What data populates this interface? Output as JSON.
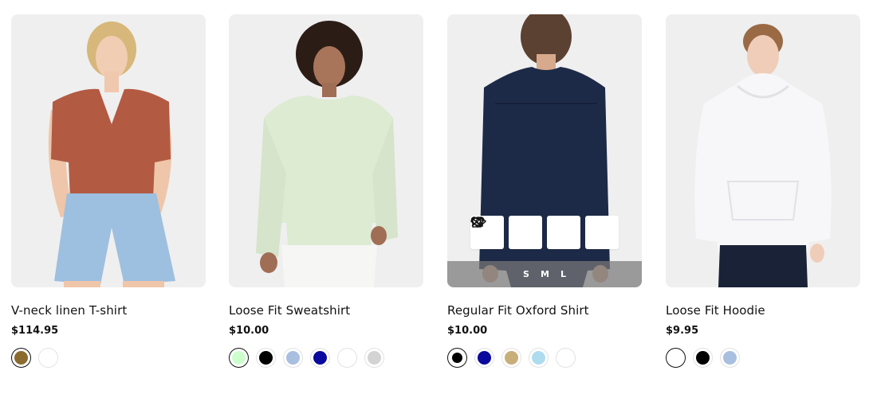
{
  "products": [
    {
      "title": "V-neck linen T-shirt",
      "price": "$114.95",
      "image_alt": "Woman in rust V-neck linen T-shirt and denim shorts",
      "swatches": [
        "#8B6B2E",
        "#FFFFFF"
      ]
    },
    {
      "title": "Loose Fit Sweatshirt",
      "price": "$10.00",
      "image_alt": "Man in pale green loose fit sweatshirt",
      "swatches": [
        "#CCFFCC",
        "#000000",
        "#A8BFE0",
        "#0A0A9E",
        "#FFFFFF",
        "#D3D3D3"
      ]
    },
    {
      "title": "Regular Fit Oxford Shirt",
      "price": "$10.00",
      "image_alt": "Back view of man in navy oxford shirt",
      "swatches": [
        "#000000",
        "#0A0A9E",
        "#C8AE78",
        "#AEDCEF",
        "#FFFFFF"
      ],
      "sizes": [
        "S",
        "M",
        "L"
      ]
    },
    {
      "title": "Loose Fit Hoodie",
      "price": "$9.95",
      "image_alt": "Man in white loose fit hoodie",
      "swatches": [
        "#FFFFFF",
        "#000000",
        "#A8BFE0"
      ]
    }
  ],
  "quick_actions": [
    "add-to-cart-icon",
    "heart-icon",
    "shuffle-compare-icon",
    "eye-icon"
  ]
}
